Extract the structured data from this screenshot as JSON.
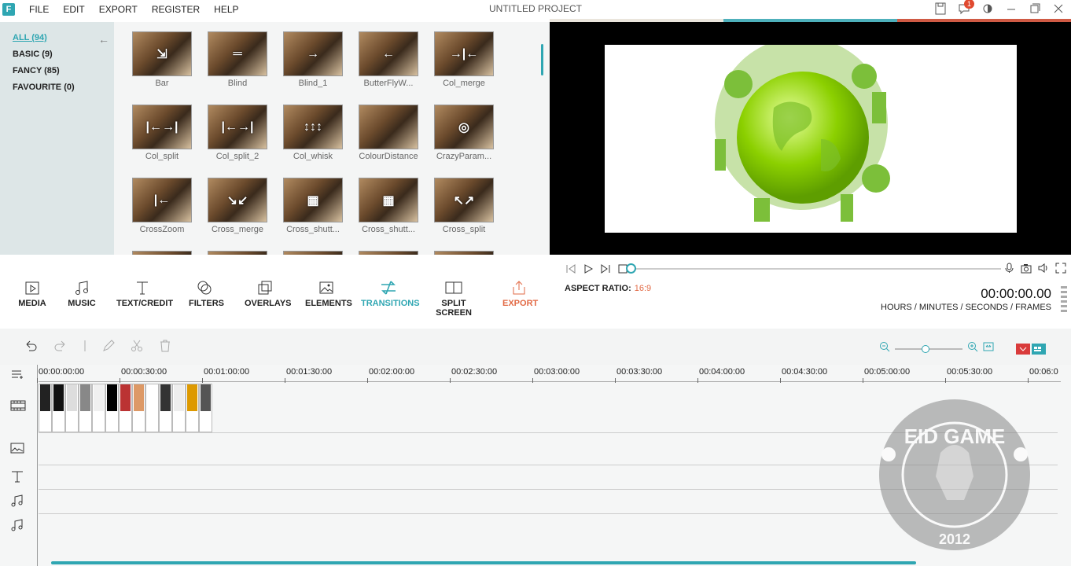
{
  "menubar": {
    "logo": "F",
    "items": [
      "FILE",
      "EDIT",
      "EXPORT",
      "REGISTER",
      "HELP"
    ],
    "title": "UNTITLED PROJECT",
    "notification_count": "1"
  },
  "categories": {
    "items": [
      {
        "label": "ALL (94)",
        "active": true
      },
      {
        "label": "BASIC (9)",
        "active": false
      },
      {
        "label": "FANCY (85)",
        "active": false
      },
      {
        "label": "FAVOURITE (0)",
        "active": false
      }
    ]
  },
  "transitions": [
    {
      "label": "Bar",
      "glyph": "⇲"
    },
    {
      "label": "Blind",
      "glyph": "═"
    },
    {
      "label": "Blind_1",
      "glyph": "→"
    },
    {
      "label": "ButterFlyW...",
      "glyph": "←"
    },
    {
      "label": "Col_merge",
      "glyph": "→|←"
    },
    {
      "label": "Col_split",
      "glyph": "|←→|"
    },
    {
      "label": "Col_split_2",
      "glyph": "|←→|"
    },
    {
      "label": "Col_whisk",
      "glyph": "↕↕↕"
    },
    {
      "label": "ColourDistance",
      "glyph": ""
    },
    {
      "label": "CrazyParam...",
      "glyph": "◎"
    },
    {
      "label": "CrossZoom",
      "glyph": "|←"
    },
    {
      "label": "Cross_merge",
      "glyph": "↘↙"
    },
    {
      "label": "Cross_shutt...",
      "glyph": "▦"
    },
    {
      "label": "Cross_shutt...",
      "glyph": "▦"
    },
    {
      "label": "Cross_split",
      "glyph": "↖↗"
    }
  ],
  "toolbar": {
    "media": "MEDIA",
    "music": "MUSIC",
    "text_credit": "TEXT/CREDIT",
    "filters": "FILTERS",
    "overlays": "OVERLAYS",
    "elements": "ELEMENTS",
    "transitions": "TRANSITIONS",
    "split_screen": "SPLIT SCREEN",
    "export": "EXPORT"
  },
  "playback": {
    "aspect_label": "ASPECT RATIO:",
    "aspect_value": "16:9",
    "timecode": "00:00:00.00",
    "timecode_units": "HOURS / MINUTES / SECONDS / FRAMES"
  },
  "ruler": [
    "00:00:00:00",
    "00:00:30:00",
    "00:01:00:00",
    "00:01:30:00",
    "00:02:00:00",
    "00:02:30:00",
    "00:03:00:00",
    "00:03:30:00",
    "00:04:00:00",
    "00:04:30:00",
    "00:05:00:00",
    "00:05:30:00",
    "00:06:0"
  ],
  "watermark": {
    "top": "EID GAME",
    "bottom": "2012"
  },
  "colors": {
    "accent": "#2fa6b2",
    "export": "#e26a45",
    "panel": "#dde6e7"
  }
}
